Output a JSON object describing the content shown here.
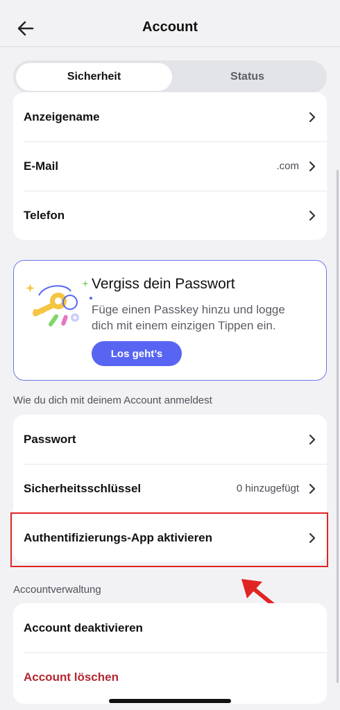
{
  "header": {
    "title": "Account"
  },
  "tabs": [
    {
      "label": "Sicherheit"
    },
    {
      "label": "Status"
    }
  ],
  "account_info": {
    "display_name": {
      "label": "Anzeigename"
    },
    "email": {
      "label": "E-Mail",
      "value": ".com"
    },
    "phone": {
      "label": "Telefon"
    }
  },
  "passkey": {
    "title": "Vergiss dein Passwort",
    "body": "Füge einen Passkey hinzu und logge dich mit einem einzigen Tippen ein.",
    "button": "Los geht’s"
  },
  "login_section": {
    "heading": "Wie du dich mit deinem Account anmeldest",
    "password": {
      "label": "Passwort"
    },
    "security_keys": {
      "label": "Sicherheitsschlüssel",
      "value": "0 hinzugefügt"
    },
    "auth_app": {
      "label": "Authentifizierungs-App aktivieren"
    }
  },
  "management_section": {
    "heading": "Accountverwaltung",
    "deactivate": {
      "label": "Account deaktivieren"
    },
    "delete": {
      "label": "Account löschen"
    }
  },
  "colors": {
    "accent": "#5865f2",
    "danger": "#b3262f",
    "highlight": "#e02424"
  }
}
